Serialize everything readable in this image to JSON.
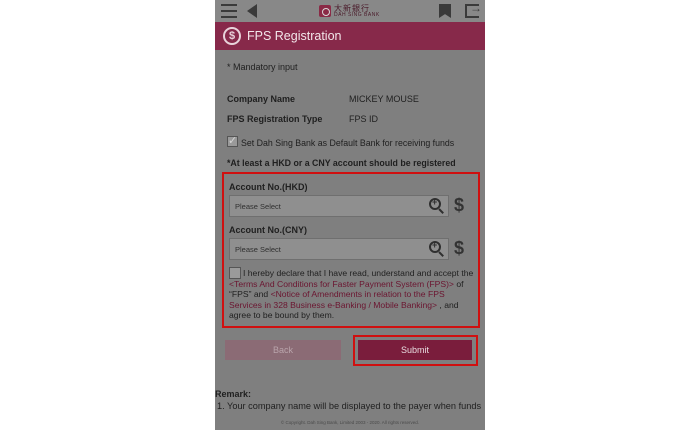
{
  "header": {
    "logo_cn": "大新銀行",
    "logo_en": "DAH SING BANK"
  },
  "title": "FPS Registration",
  "form": {
    "mandatory_note": "* Mandatory input",
    "company_label": "Company Name",
    "company_value": "MICKEY MOUSE",
    "fps_type_label": "FPS Registration Type",
    "fps_type_value": "FPS ID",
    "default_bank_label": "Set Dah Sing Bank as Default Bank for receiving funds",
    "account_note": "*At least a HKD or a CNY account should be registered",
    "hkd_label": "Account No.(HKD)",
    "hkd_placeholder": "Please Select",
    "cny_label": "Account No.(CNY)",
    "cny_placeholder": "Please Select",
    "declare_pre": "I hereby declare that I have read, understand and accept the ",
    "declare_link1": "<Terms And Conditions for Faster Payment System (FPS)>",
    "declare_mid": " of “FPS” and  ",
    "declare_link2": "<Notice of Amendments in relation to the FPS Services in 328 Business e-Banking / Mobile Banking>",
    "declare_post": " , and agree to be bound by them."
  },
  "buttons": {
    "back": "Back",
    "submit": "Submit"
  },
  "remark": {
    "title": "Remark:",
    "item1": "1. Your company name will be displayed to the payer when funds"
  },
  "footer": "© Copyright. Dah Sing Bank, Limited 2003 - 2020. All rights reserved."
}
